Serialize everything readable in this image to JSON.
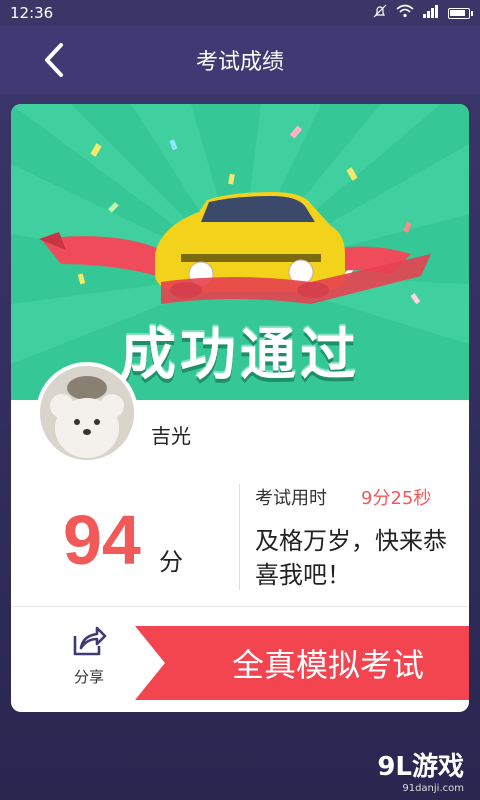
{
  "status_bar": {
    "time": "12:36"
  },
  "header": {
    "title": "考试成绩"
  },
  "banner": {
    "title": "成功通过"
  },
  "user": {
    "name": "吉光"
  },
  "result": {
    "score": "94",
    "score_unit": "分",
    "time_label": "考试用时",
    "time_value": "9分25秒",
    "message": "及格万岁，快来恭喜我吧！"
  },
  "actions": {
    "share_label": "分享",
    "mock_exam_label": "全真模拟考试"
  },
  "watermark": {
    "main": "9L游戏",
    "sub": "91danji.com"
  },
  "colors": {
    "accent_red": "#f25a5a",
    "banner_green": "#35c896",
    "header_purple": "#3f3a73",
    "car_yellow": "#f2d21a"
  },
  "icons": [
    "back-icon",
    "share-icon",
    "signal-icon",
    "wifi-icon",
    "battery-icon",
    "mute-icon"
  ]
}
